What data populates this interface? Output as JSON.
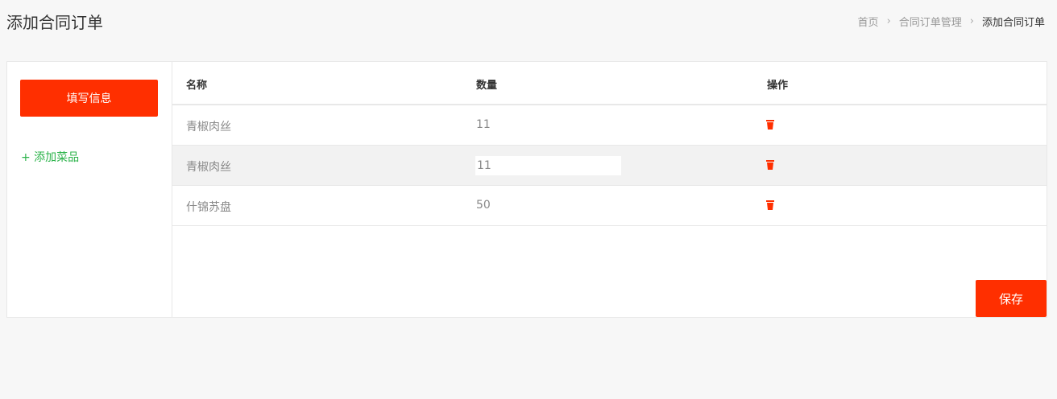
{
  "page_title": "添加合同订单",
  "breadcrumb": {
    "items": [
      "首页",
      "合同订单管理",
      "添加合同订单"
    ],
    "separator": "›"
  },
  "sidebar": {
    "fill_info_label": "填写信息",
    "add_dish_label": "+ 添加菜品"
  },
  "table": {
    "headers": {
      "name": "名称",
      "qty": "数量",
      "action": "操作"
    },
    "rows": [
      {
        "name": "青椒肉丝",
        "qty": "11",
        "editing": false
      },
      {
        "name": "青椒肉丝",
        "qty": "11",
        "editing": true
      },
      {
        "name": "什锦苏盘",
        "qty": "50",
        "editing": false
      }
    ]
  },
  "save_label": "保存",
  "colors": {
    "accent": "#ff2f00",
    "link_green": "#2bb34a",
    "background": "#f7f7f7"
  },
  "icons": {
    "row_action": "trash-icon",
    "breadcrumb_separator": "chevron-right-icon"
  }
}
